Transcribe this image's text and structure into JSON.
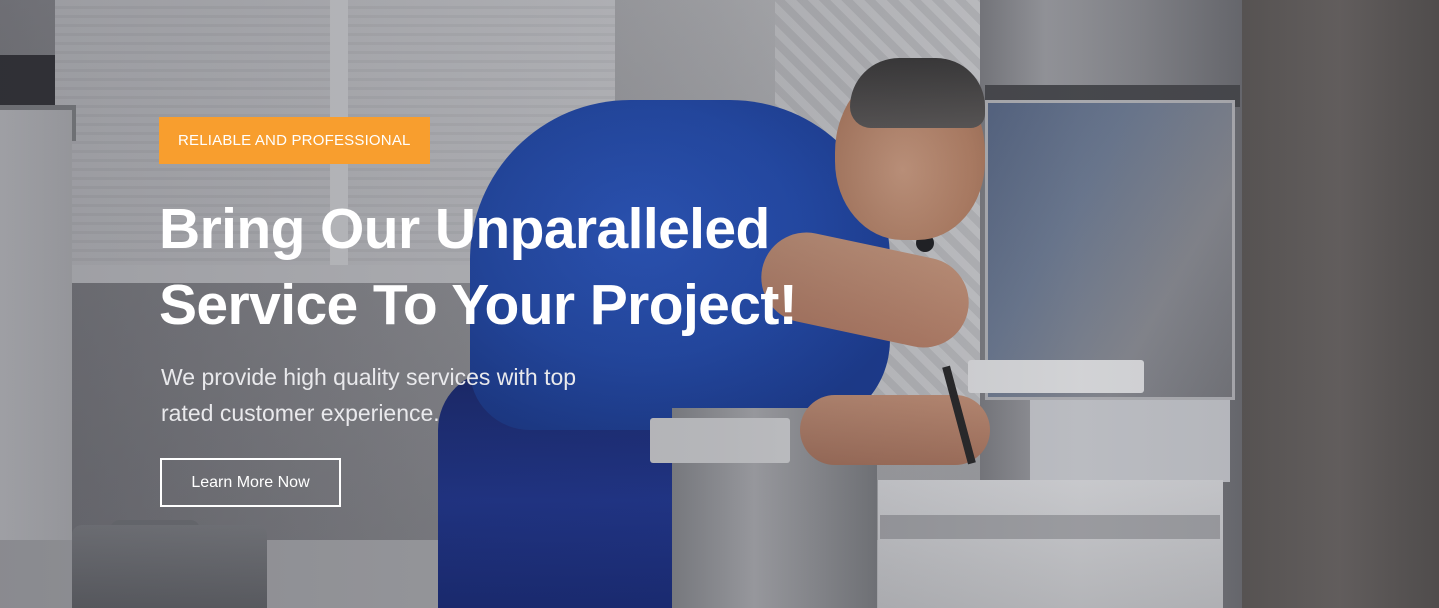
{
  "hero": {
    "badge": "RELIABLE AND PROFESSIONAL",
    "headline_line1": "Bring Our Unparalleled",
    "headline_line2": "Service To Your Project!",
    "subtext_line1": "We provide high quality services with top",
    "subtext_line2": "rated customer experience.",
    "cta_label": "Learn More Now"
  },
  "colors": {
    "badge_bg": "#f89e2e",
    "text": "#ffffff",
    "cta_border": "#ffffff"
  }
}
